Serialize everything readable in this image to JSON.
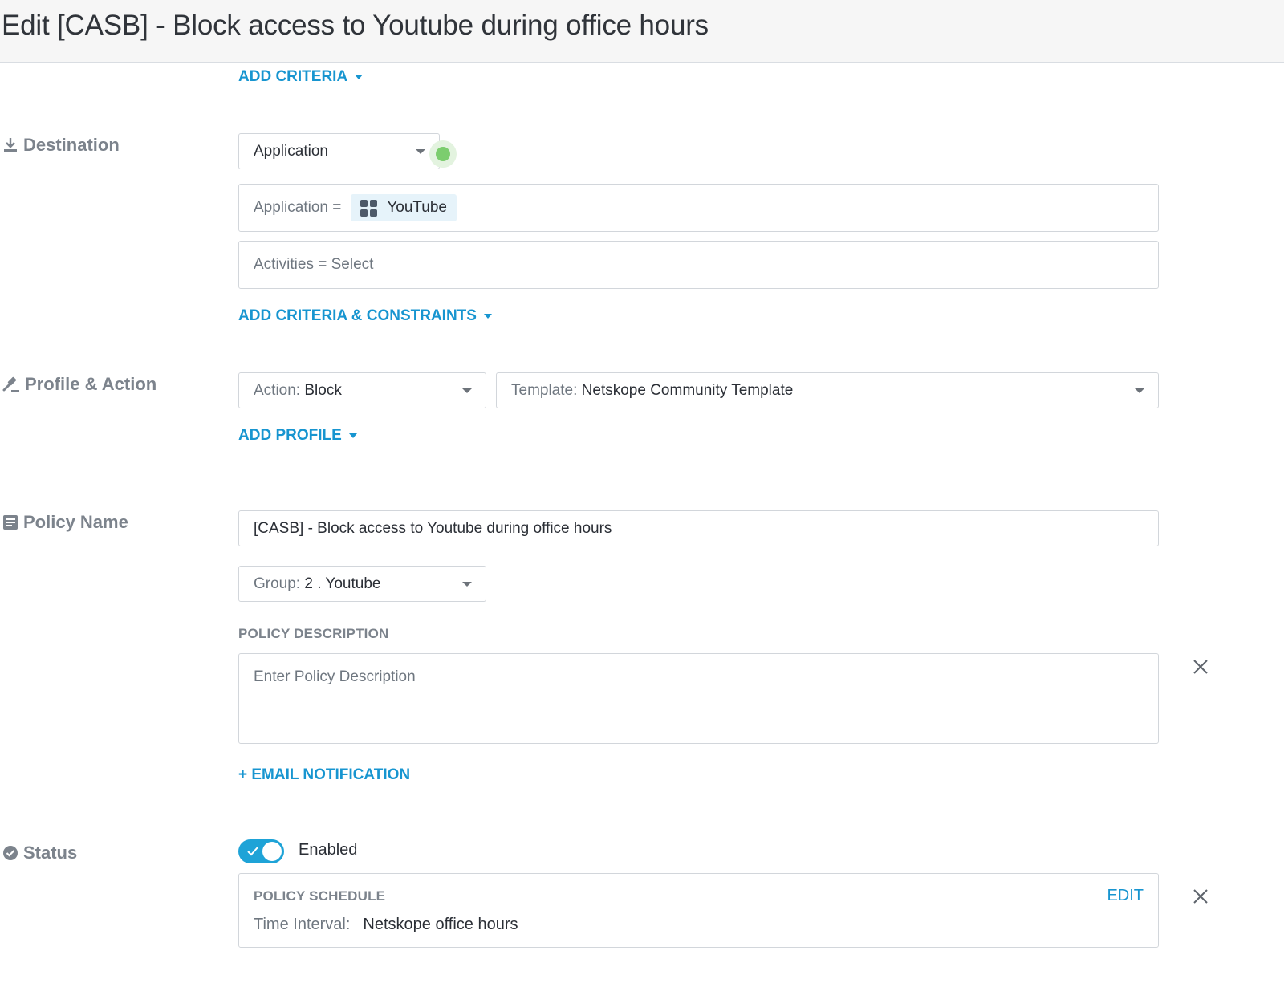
{
  "header": {
    "title": "Edit [CASB] - Block access to Youtube during office hours"
  },
  "source": {
    "add_criteria_label": "ADD CRITERIA"
  },
  "destination": {
    "label": "Destination",
    "type_select": "Application",
    "application_prefix": "Application =",
    "application_chip": "YouTube",
    "activities_text": "Activities = Select",
    "add_criteria_constraints_label": "ADD CRITERIA & CONSTRAINTS"
  },
  "profile_action": {
    "label": "Profile & Action",
    "action_prefix": "Action:",
    "action_value": "Block",
    "template_prefix": "Template:",
    "template_value": "Netskope Community Template",
    "add_profile_label": "ADD PROFILE"
  },
  "policy": {
    "label": "Policy Name",
    "name_value": "[CASB] - Block access to Youtube during office hours",
    "group_prefix": "Group:",
    "group_value": "2 . Youtube",
    "description_heading": "POLICY DESCRIPTION",
    "description_placeholder": "Enter Policy Description",
    "email_notification_label": "+ EMAIL NOTIFICATION"
  },
  "status": {
    "label": "Status",
    "toggle_label": "Enabled",
    "enabled": true,
    "schedule_heading": "POLICY SCHEDULE",
    "edit_label": "EDIT",
    "time_interval_prefix": "Time Interval:",
    "time_interval_value": "Netskope office hours"
  },
  "colors": {
    "accent": "#1795d0",
    "toggle": "#1ea3d7",
    "status_dot": "#7ccd6e"
  },
  "icons": [
    "download-icon",
    "gavel-icon",
    "document-icon",
    "check-circle-icon",
    "app-grid-icon",
    "close-icon",
    "checkmark-icon"
  ]
}
